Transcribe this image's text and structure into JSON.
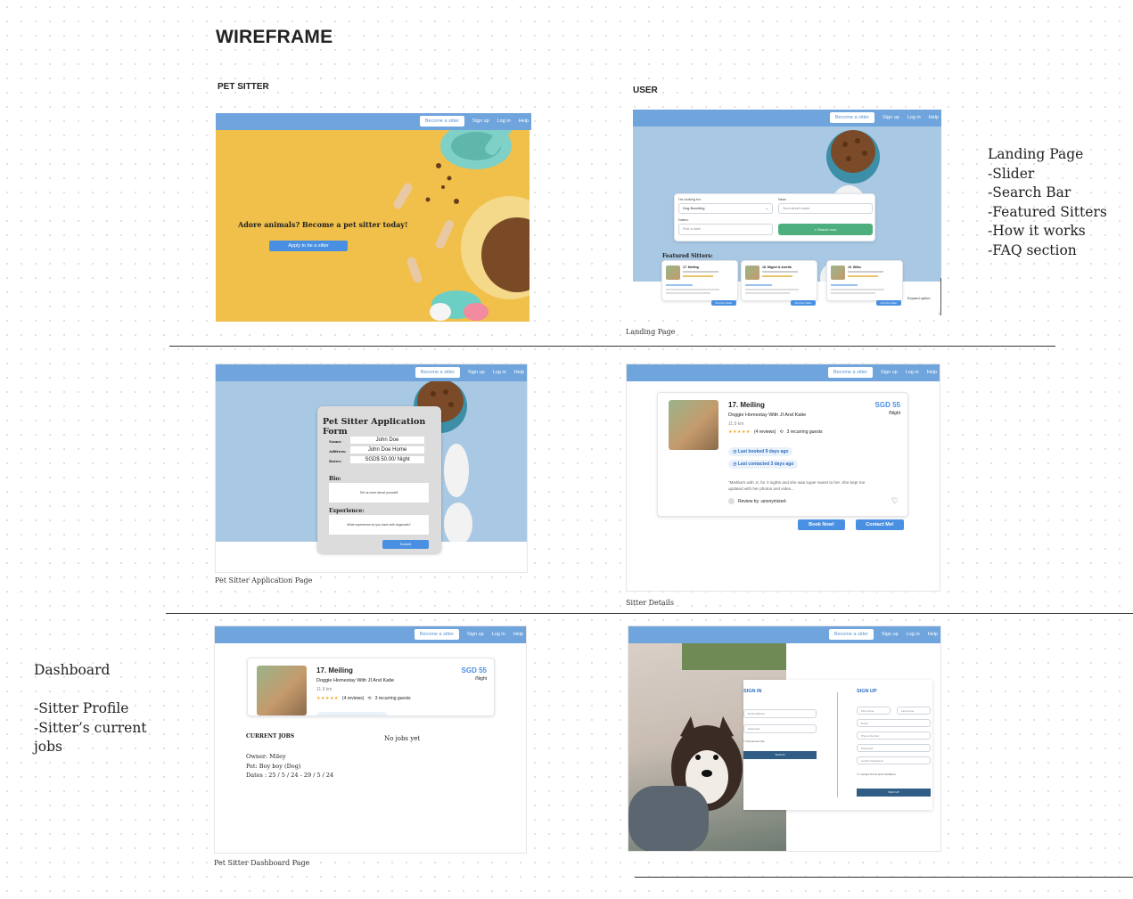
{
  "wireframe_title": "WIREFRAME",
  "sections": {
    "pet_sitter": "PET SITTER",
    "user": "USER"
  },
  "notes": {
    "landing": [
      "Landing Page",
      "",
      "-Slider",
      "-Search Bar",
      "-Featured Sitters",
      "-How it works",
      "-FAQ section"
    ],
    "dashboard": [
      "Dashboard",
      "",
      "-Sitter Profile",
      "-Sitter’s current",
      "jobs"
    ]
  },
  "captions": {
    "landing": "Landing Page",
    "application": "Pet Sitter Application Page",
    "details": "Sitter Details",
    "dashboard": "Pet Sitter  Dashboard Page"
  },
  "nav": {
    "become": "Become a sitter",
    "signup": "Sign up",
    "login": "Log in",
    "help": "Help"
  },
  "hero": {
    "headline": "Adore animals? Become a pet sitter today!",
    "cta": "Apply to be a sitter"
  },
  "search": {
    "looking_label": "I'm looking for:",
    "looking_value": "Dog Boarding",
    "near_label": "Near:",
    "near_placeholder": "Your street name",
    "dates_label": "Dates:",
    "dates_placeholder": "Pick a date",
    "button": "Search now",
    "featured_title": "Featured Sitters:",
    "expand": "Expand option"
  },
  "featured": [
    {
      "name": "17. Meiling",
      "btn": "Find the Sitter"
    },
    {
      "name": "18. Miguel & Amelia",
      "btn": "Find the Sitter"
    },
    {
      "name": "19. Wilks",
      "btn": "Find the Sitter"
    }
  ],
  "application": {
    "title": "Pet Sitter Application  Form",
    "name_label": "Name:",
    "name_value": "John Doe",
    "address_label": "Address:",
    "address_value": "John Doe Home",
    "rates_label": "Rates:",
    "rates_value": "SGD$ 50.00/ Night",
    "bio_label": "Bio:",
    "bio_placeholder": "Tell us more about yourself!",
    "exp_label": "Experience:",
    "exp_placeholder": "What experience do you have with dogs/cats?",
    "submit": "Submit"
  },
  "sitter": {
    "name": "17. Meiling",
    "price": "SGD 55",
    "per": "/Night",
    "desc": "Doggie Homestay With JI And Katie",
    "distance": "11.9 km",
    "stars": "★★★★★",
    "reviews": "(4 reviews)",
    "recurring": "3 recurring guests",
    "last_booked": "Last booked 9 days ago",
    "last_contacted": "Last contacted 3 days ago",
    "review_text": "\"Mishka's with JI, for 3 nights and she was super sweet to her. She kept me updated with her photos and video...",
    "review_by": "Review by -anonymized-",
    "book": "Book Now!",
    "contact": "Contact Me!"
  },
  "dashboard": {
    "current_jobs": "CURRENT JOBS",
    "no_jobs": "No jobs yet",
    "owner": "Owner: Miley",
    "pet": "Pet: Boy boy (Dog)",
    "dates": "Dates : 25 / 5 / 24 - 29 / 5 / 24"
  },
  "auth": {
    "signin": "SIGN IN",
    "signup": "SIGN UP",
    "signin_fields": [
      "Email address",
      "Password"
    ],
    "remember": "Remember Me",
    "signin_btn": "SIGN IN",
    "signup_fields": [
      "First name",
      "Last name",
      "Email",
      "Phone Number",
      "Password",
      "Confirm Password"
    ],
    "agree": "I accept Terms and Conditions",
    "signup_btn": "SIGN UP"
  },
  "colors": {
    "nav": "#6fa5dc",
    "primary": "#4a90e2",
    "green": "#4caf7d",
    "hero_yellow": "#f0c04a",
    "sky": "#a9c8e3"
  }
}
